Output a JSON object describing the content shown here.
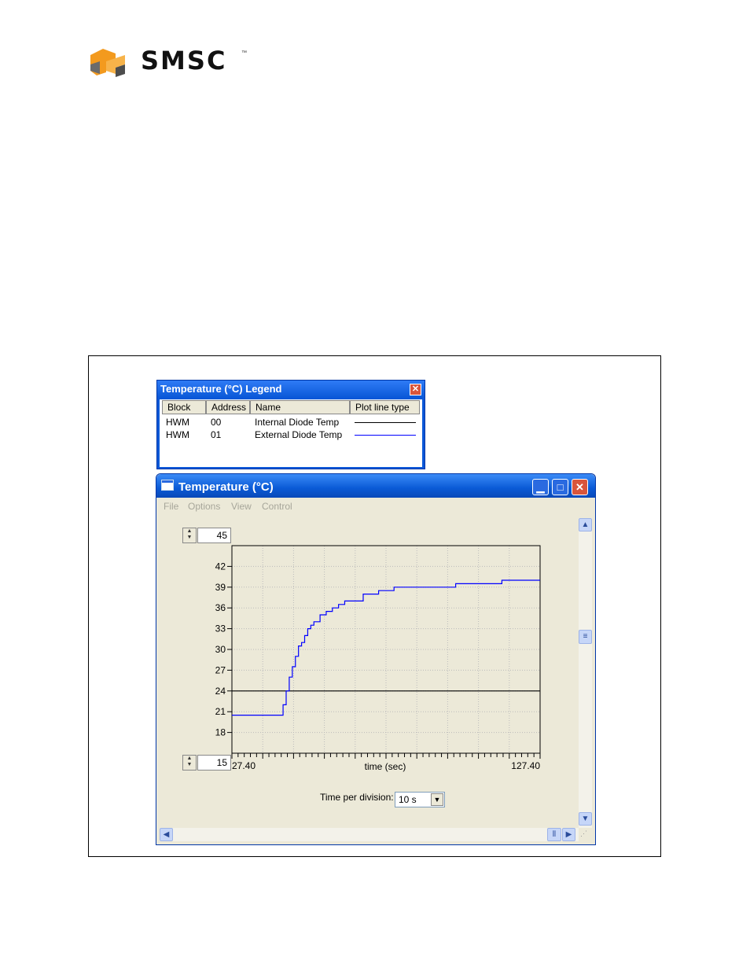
{
  "logo": {
    "text": "SMSC",
    "tm": "™"
  },
  "legend": {
    "title": "Temperature (°C) Legend",
    "columns": [
      "Block",
      "Address",
      "Name",
      "Plot line type"
    ],
    "rows": [
      {
        "block": "HWM",
        "address": "00",
        "name": "Internal Diode Temp",
        "color": "#000000"
      },
      {
        "block": "HWM",
        "address": "01",
        "name": "External Diode Temp",
        "color": "#0000ff"
      }
    ]
  },
  "window": {
    "title": "Temperature (°C)",
    "menu": [
      "File",
      "Options",
      "View",
      "Control"
    ],
    "upper_limit": "45",
    "lower_limit": "15",
    "time_per_division_label": "Time per division:",
    "time_per_division_value": "10 s"
  },
  "chart_data": {
    "type": "line",
    "xlabel": "time (sec)",
    "xlim": [
      27.4,
      127.4
    ],
    "x_tick_labels": [
      "27.40",
      "127.40"
    ],
    "ylim": [
      15,
      45
    ],
    "y_ticks": [
      18,
      21,
      24,
      27,
      30,
      33,
      36,
      39,
      42
    ],
    "grid": true,
    "series": [
      {
        "name": "Internal Diode Temp",
        "color": "#000000",
        "x": [
          27.4,
          127.4
        ],
        "y": [
          24,
          24
        ]
      },
      {
        "name": "External Diode Temp",
        "color": "#0000ff",
        "x": [
          27.4,
          42.5,
          44,
          45,
          46,
          47,
          48,
          49,
          50,
          51,
          52,
          53,
          54,
          56,
          58,
          60,
          62,
          64,
          66,
          70,
          75,
          80,
          85,
          90,
          95,
          100,
          110,
          115,
          127.4
        ],
        "y": [
          20.5,
          20.5,
          22,
          24,
          26,
          27.5,
          29,
          30.5,
          31,
          32,
          33,
          33.5,
          34,
          35,
          35.5,
          36,
          36.5,
          37,
          37,
          38,
          38.5,
          39,
          39,
          39,
          39,
          39.5,
          39.5,
          40,
          40
        ]
      }
    ]
  }
}
